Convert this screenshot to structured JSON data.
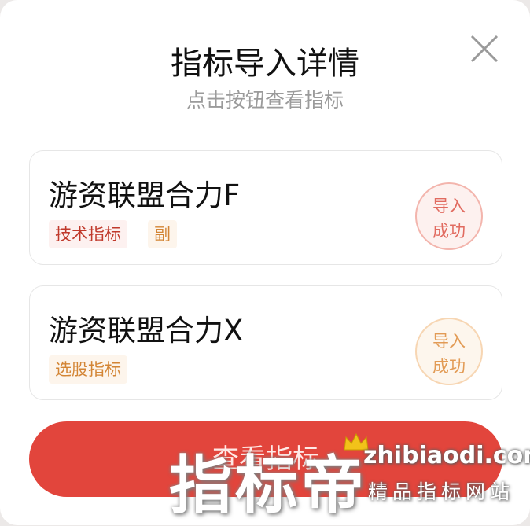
{
  "dialog": {
    "title": "指标导入详情",
    "subtitle": "点击按钮查看指标",
    "close_icon": "close-icon"
  },
  "items": [
    {
      "name": "游资联盟合力F",
      "tags": [
        "技术指标",
        "副"
      ],
      "status": [
        "导入",
        "成功"
      ]
    },
    {
      "name": "游资联盟合力X",
      "tags": [
        "选股指标"
      ],
      "status": [
        "导入",
        "成功"
      ]
    }
  ],
  "primary_button": {
    "label": "查看指标"
  },
  "watermark": {
    "logo_text": "指标帝",
    "domain": "zhibiaodi.com",
    "tagline": "精品指标网站"
  },
  "colors": {
    "accent_red": "#e2453c",
    "tag_red_text": "#c0392b",
    "tag_orange_text": "#d38535",
    "stamp_red": "#e16b60",
    "stamp_orange": "#e29b55"
  }
}
